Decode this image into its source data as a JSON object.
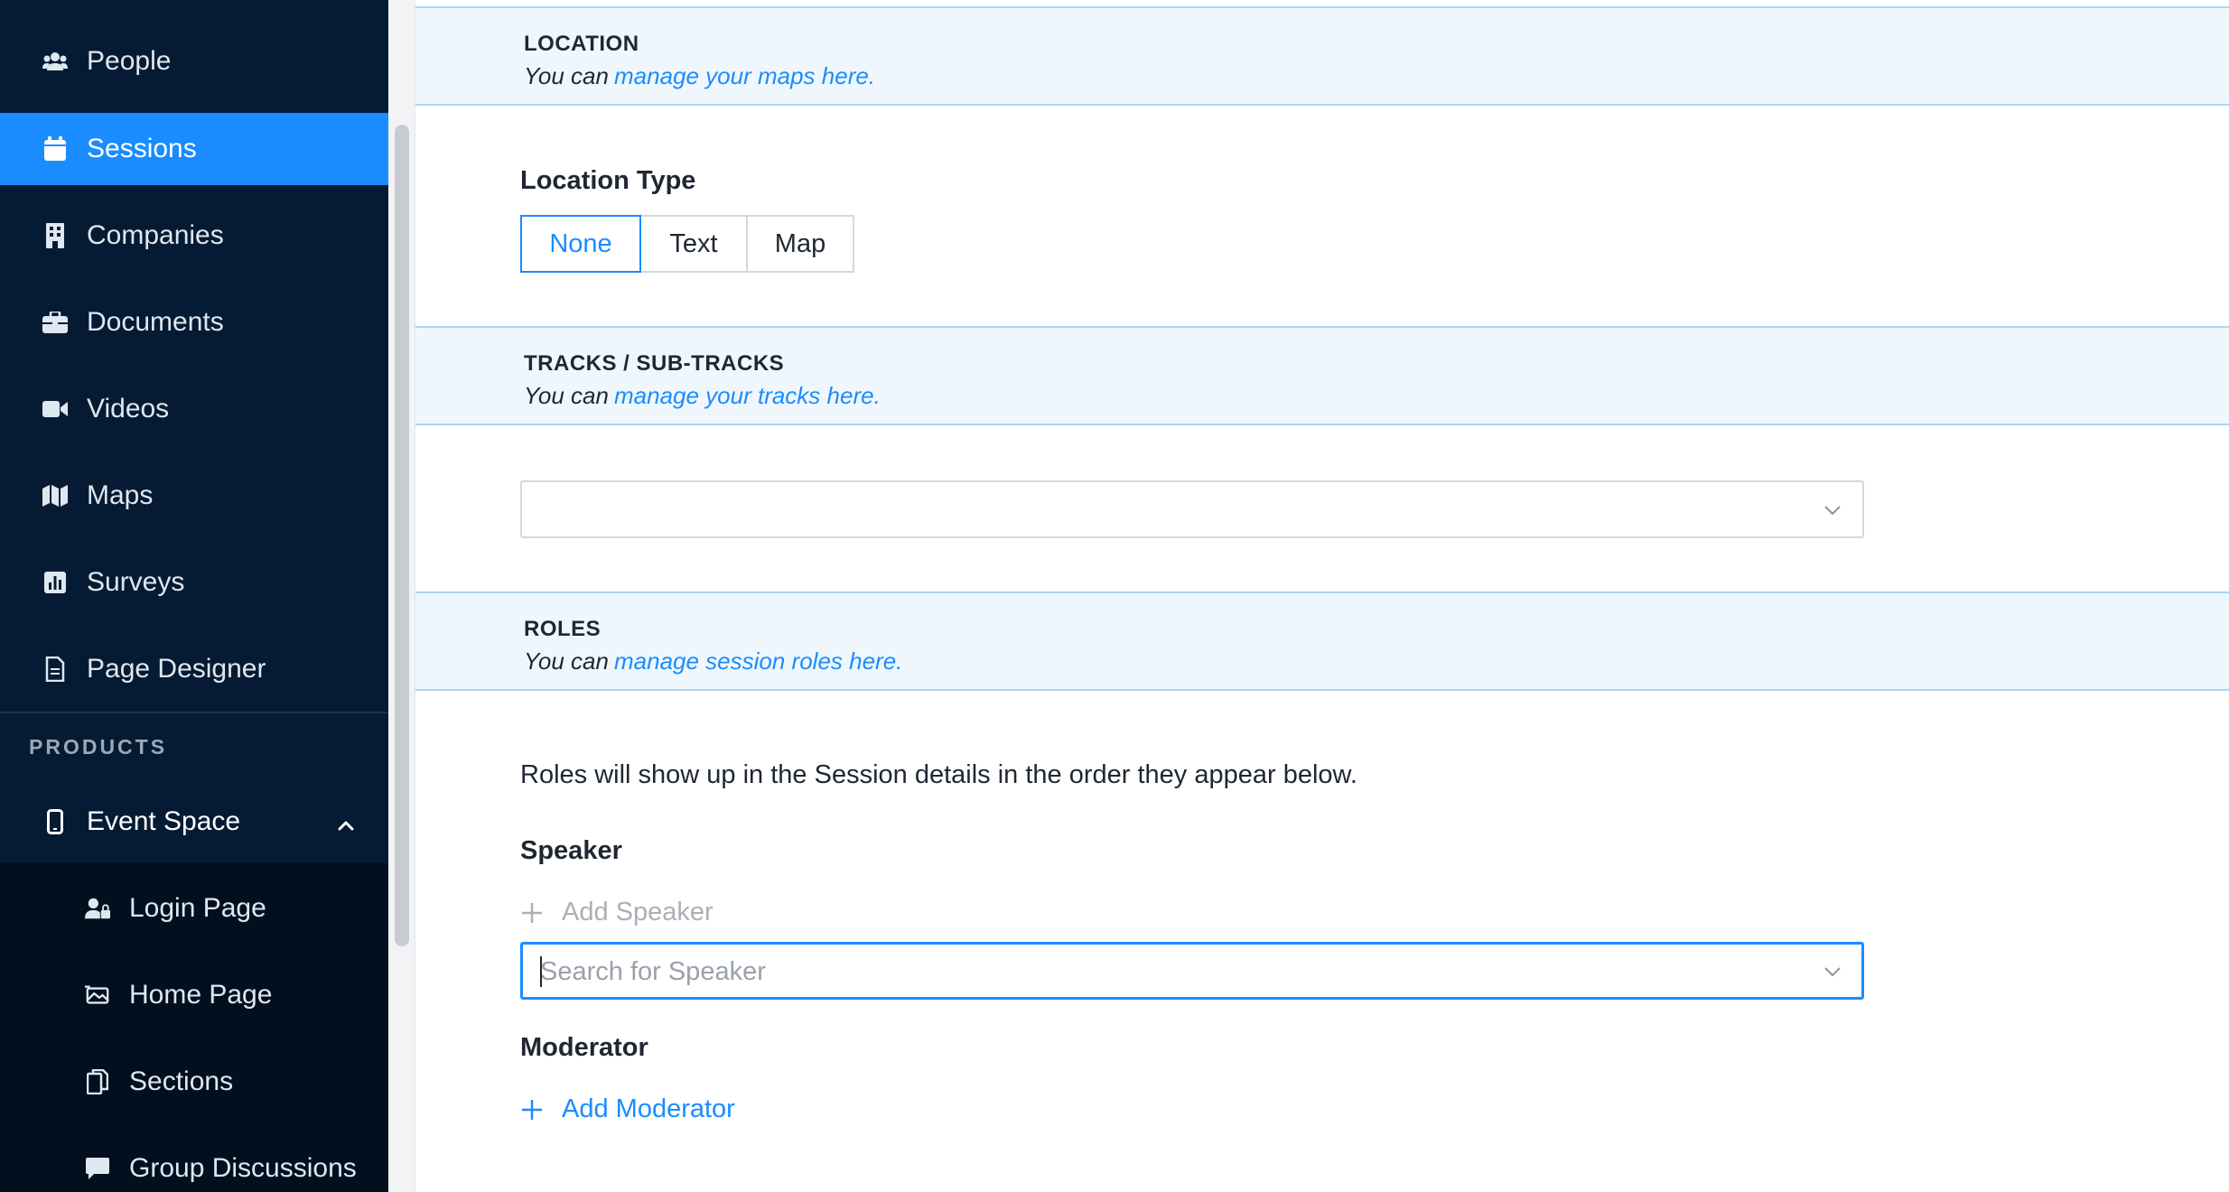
{
  "sidebar": {
    "items": [
      {
        "label": "People",
        "icon": "users-icon"
      },
      {
        "label": "Sessions",
        "icon": "calendar-icon"
      },
      {
        "label": "Companies",
        "icon": "building-icon"
      },
      {
        "label": "Documents",
        "icon": "briefcase-icon"
      },
      {
        "label": "Videos",
        "icon": "video-icon"
      },
      {
        "label": "Maps",
        "icon": "map-icon"
      },
      {
        "label": "Surveys",
        "icon": "chart-icon"
      },
      {
        "label": "Page Designer",
        "icon": "file-icon"
      }
    ],
    "active": "Sessions",
    "section_title": "PRODUCTS",
    "product": {
      "label": "Event Space",
      "icon": "mobile-icon"
    },
    "sub_items": [
      {
        "label": "Login Page",
        "icon": "user-lock-icon"
      },
      {
        "label": "Home Page",
        "icon": "home-page-icon"
      },
      {
        "label": "Sections",
        "icon": "copy-icon"
      },
      {
        "label": "Group Discussions",
        "icon": "comment-icon"
      }
    ]
  },
  "location": {
    "title": "LOCATION",
    "sub_prefix": "You can",
    "sub_link": "manage your maps here.",
    "type_label": "Location Type",
    "options": [
      "None",
      "Text",
      "Map"
    ],
    "selected": "None"
  },
  "tracks": {
    "title": "TRACKS / SUB-TRACKS",
    "sub_prefix": "You can",
    "sub_link": "manage your tracks here."
  },
  "roles": {
    "title": "ROLES",
    "sub_prefix": "You can",
    "sub_link": "manage session roles here.",
    "description": "Roles will show up in the Session details in the order they appear below.",
    "speaker_label": "Speaker",
    "add_speaker": "Add Speaker",
    "speaker_search_placeholder": "Search for Speaker",
    "moderator_label": "Moderator",
    "add_moderator": "Add Moderator"
  },
  "colors": {
    "accent": "#1a8cff",
    "sidebar_bg": "#051b33",
    "band_bg": "#eff7fd"
  }
}
